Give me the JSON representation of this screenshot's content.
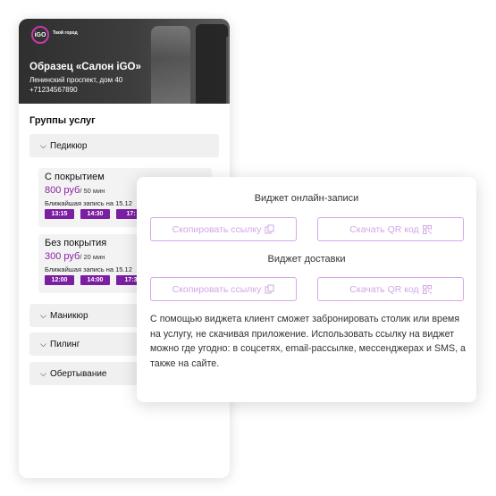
{
  "salon": {
    "logo_text": "iGO",
    "logo_subtitle": "Твой город",
    "name": "Образец «Салон iGO»",
    "address": "Ленинский проспект, дом 40",
    "phone": "+71234567890"
  },
  "groups_title": "Группы услуг",
  "groups": [
    {
      "label": "Педикюр",
      "expanded": true
    },
    {
      "label": "Маникюр",
      "expanded": false
    },
    {
      "label": "Пилинг",
      "expanded": false
    },
    {
      "label": "Обертывание",
      "expanded": false
    }
  ],
  "services": [
    {
      "name": "С покрытием",
      "price": "800 руб",
      "duration": "/ 50 мин",
      "next_label": "Ближайшая запись на 15.12",
      "slots": [
        "13:15",
        "14:30",
        "17:"
      ]
    },
    {
      "name": "Без покрытия",
      "price": "300 руб",
      "duration": "/ 20 мин",
      "next_label": "Ближайшая запись на 15.12",
      "slots": [
        "12:00",
        "14:00",
        "17:3"
      ]
    }
  ],
  "widget": {
    "booking_title": "Виджет онлайн-записи",
    "delivery_title": "Виджет доставки",
    "copy_link_label": "Скопировать ссылку",
    "qr_label": "Скачать QR код",
    "description": "С помощью виджета клиент сможет забронировать столик или время на услугу, не скачивая приложение. Использовать ссылку на виджет можно где угодно: в соцсетях, email-рассылке, мессенджерах и SMS, а также на сайте."
  },
  "colors": {
    "accent": "#7b1fa2",
    "price": "#8a1fa1",
    "button_outline": "#d6a6e8",
    "button_text": "#d2a7e6"
  }
}
